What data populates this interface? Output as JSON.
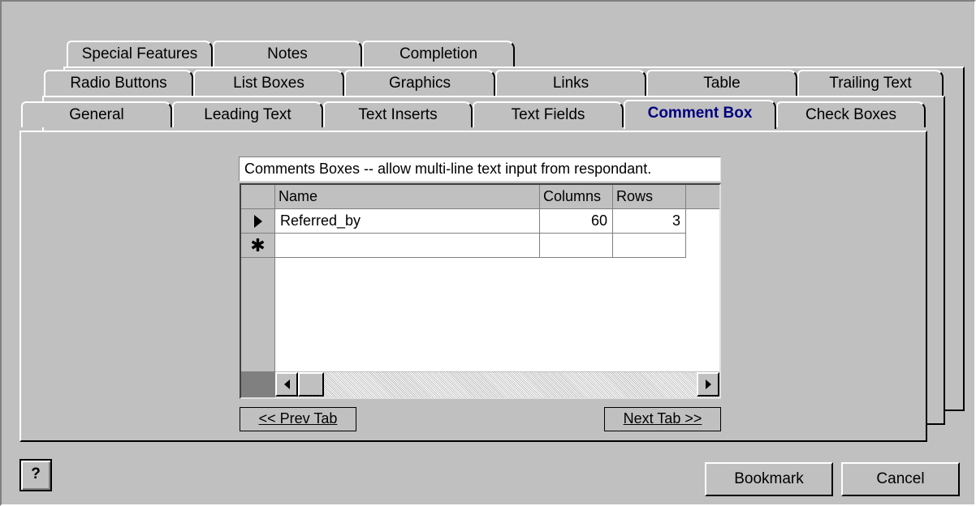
{
  "tabs": {
    "row_top": [
      "Special Features",
      "Notes",
      "Completion"
    ],
    "row_mid": [
      "Radio Buttons",
      "List Boxes",
      "Graphics",
      "Links",
      "Table",
      "Trailing Text"
    ],
    "row_front": [
      "General",
      "Leading Text",
      "Text Inserts",
      "Text Fields",
      "Comment Box",
      "Check Boxes"
    ],
    "active": "Comment Box"
  },
  "description": "Comments Boxes -- allow multi-line text input from respondant.",
  "grid": {
    "columns": [
      "Name",
      "Columns",
      "Rows"
    ],
    "rows": [
      {
        "selector": "current-record",
        "name": "Referred_by",
        "columns": "60",
        "rows": "3"
      },
      {
        "selector": "new-record",
        "name": "",
        "columns": "",
        "rows": ""
      }
    ]
  },
  "nav": {
    "prev": "<< Prev Tab",
    "next": "Next Tab >>"
  },
  "buttons": {
    "help": "?",
    "bookmark": "Bookmark",
    "cancel": "Cancel"
  },
  "colors": {
    "face": "#c0c0c0",
    "active_tab_text": "#000080",
    "window": "#ffffff"
  }
}
